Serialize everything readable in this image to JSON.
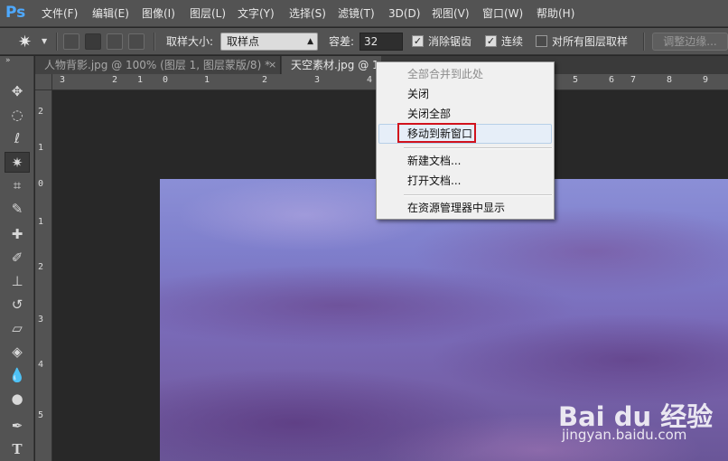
{
  "app": {
    "logo": "Ps"
  },
  "menubar": {
    "items": [
      "文件(F)",
      "编辑(E)",
      "图像(I)",
      "图层(L)",
      "文字(Y)",
      "选择(S)",
      "滤镜(T)",
      "3D(D)",
      "视图(V)",
      "窗口(W)",
      "帮助(H)"
    ]
  },
  "options": {
    "tool_icon": "magic-wand-icon",
    "sample_size_label": "取样大小:",
    "sample_size_value": "取样点",
    "tolerance_label": "容差:",
    "tolerance_value": "32",
    "antialias_label": "消除锯齿",
    "antialias_checked": true,
    "contiguous_label": "连续",
    "contiguous_checked": true,
    "all_layers_label": "对所有图层取样",
    "all_layers_checked": false,
    "refine_edge_label": "调整边缘..."
  },
  "tabs": [
    {
      "title": "人物背影.jpg @ 100% (图层 1, 图层蒙版/8) *",
      "close": "×",
      "active": false
    },
    {
      "title": "天空素材.jpg @ 1",
      "close": "",
      "active": true
    }
  ],
  "rulers": {
    "top": [
      "3",
      "2",
      "1",
      "0",
      "1",
      "2",
      "3",
      "4",
      "5",
      "6",
      "7",
      "8",
      "9"
    ],
    "left": [
      "2",
      "1",
      "0",
      "1",
      "2",
      "3",
      "4",
      "5"
    ]
  },
  "context_menu": {
    "items": [
      {
        "label": "全部合并到此处",
        "disabled": true
      },
      {
        "label": "关闭",
        "disabled": false
      },
      {
        "label": "关闭全部",
        "disabled": false
      },
      {
        "label": "移动到新窗口",
        "disabled": false,
        "highlighted": true
      },
      {
        "label": "新建文档...",
        "disabled": false
      },
      {
        "label": "打开文档...",
        "disabled": false
      },
      {
        "label": "在资源管理器中显示",
        "disabled": false
      }
    ]
  },
  "watermark": {
    "logo": "Bai du 经验",
    "url": "jingyan.baidu.com"
  }
}
